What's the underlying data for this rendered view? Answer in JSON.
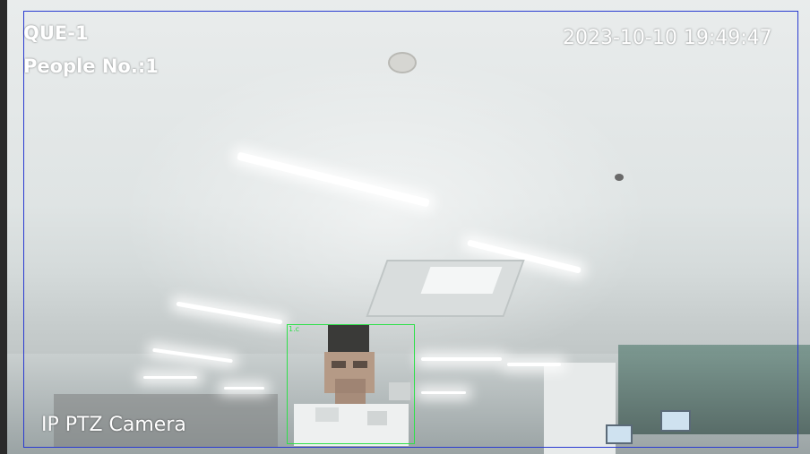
{
  "overlay": {
    "rule_name": "QUE-1",
    "people_count": "People No.:1",
    "timestamp": "2023-10-10 19:49:47",
    "camera_name": "IP PTZ Camera"
  },
  "detection": {
    "label": "1.c"
  },
  "colors": {
    "roi_box": "#2a3bd1",
    "detection_box": "#2ee04a",
    "osd_text": "#ffffff"
  }
}
